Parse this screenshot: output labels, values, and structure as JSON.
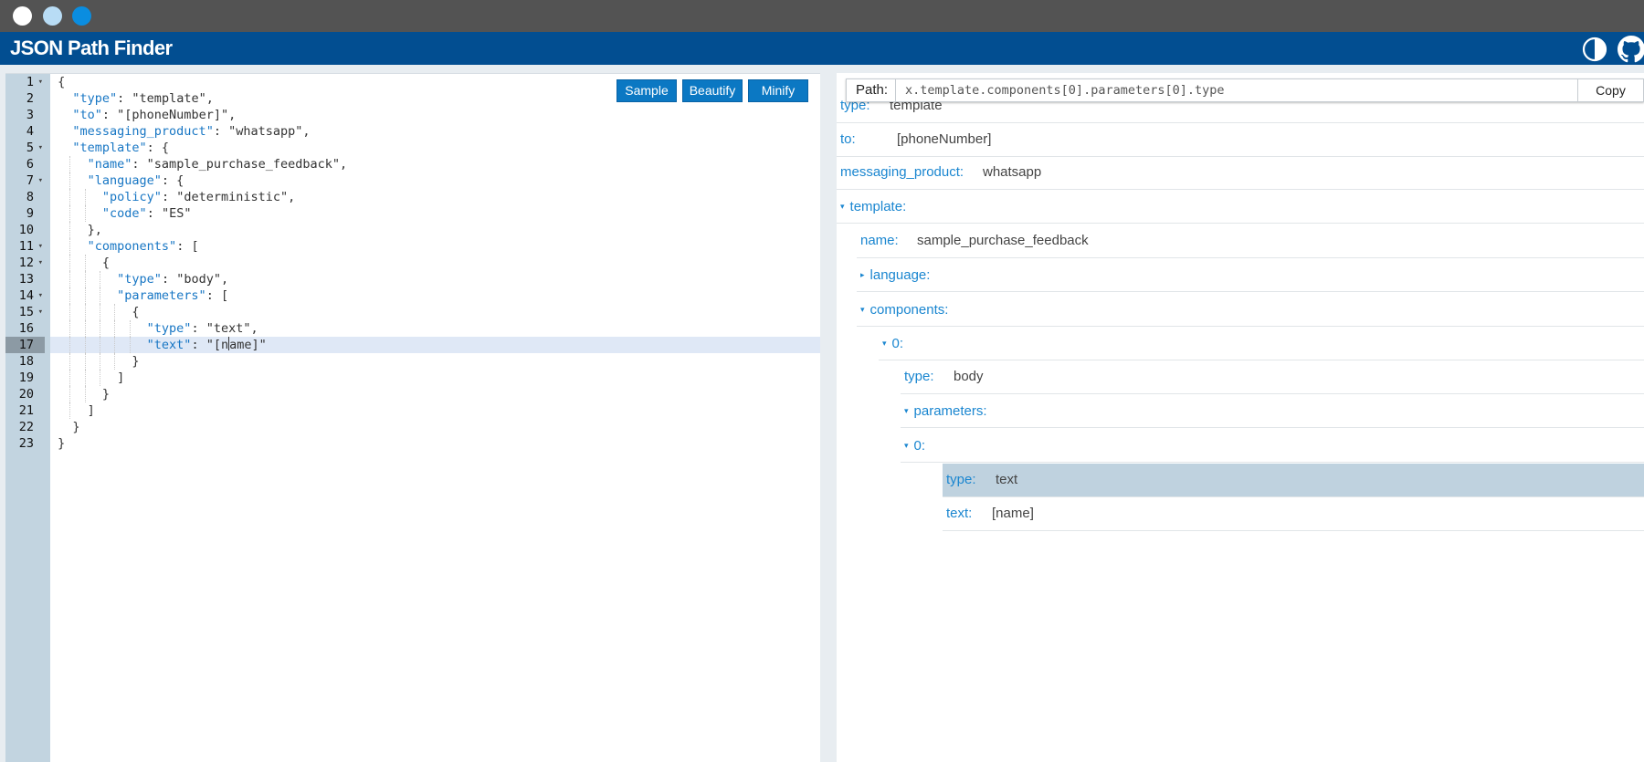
{
  "app": {
    "title": "JSON Path Finder"
  },
  "header_icons": {
    "theme": "contrast-toggle-icon",
    "github": "github-icon"
  },
  "editor": {
    "buttons": {
      "sample": "Sample",
      "beautify": "Beautify",
      "minify": "Minify"
    },
    "active_line": 17,
    "lines": [
      "{",
      "  \"type\": \"template\",",
      "  \"to\": \"[phoneNumber]\",",
      "  \"messaging_product\": \"whatsapp\",",
      "  \"template\": {",
      "    \"name\": \"sample_purchase_feedback\",",
      "    \"language\": {",
      "      \"policy\": \"deterministic\",",
      "      \"code\": \"ES\"",
      "    },",
      "    \"components\": [",
      "      {",
      "        \"type\": \"body\",",
      "        \"parameters\": [",
      "          {",
      "            \"type\": \"text\",",
      "            \"text\": \"[name]\"",
      "          }",
      "        ]",
      "      }",
      "    ]",
      "  }",
      "}"
    ],
    "foldable_lines": [
      1,
      5,
      7,
      11,
      12,
      14,
      15
    ]
  },
  "path": {
    "label": "Path:",
    "value": "x.template.components[0].parameters[0].type",
    "copy": "Copy"
  },
  "tree": [
    {
      "key": "type:",
      "value": "template",
      "depth": 0
    },
    {
      "key": "to:",
      "value": "[phoneNumber]",
      "depth": 0
    },
    {
      "key": "messaging_product:",
      "value": "whatsapp",
      "depth": 0
    },
    {
      "key": "template:",
      "value": "",
      "depth": 0,
      "arrow": "▾"
    },
    {
      "key": "name:",
      "value": "sample_purchase_feedback",
      "depth": 1
    },
    {
      "key": "language:",
      "value": "",
      "depth": 1,
      "arrow": "▸"
    },
    {
      "key": "components:",
      "value": "",
      "depth": 1,
      "arrow": "▾"
    },
    {
      "key": "0:",
      "value": "",
      "depth": 2,
      "arrow": "▾"
    },
    {
      "key": "type:",
      "value": "body",
      "depth": 3
    },
    {
      "key": "parameters:",
      "value": "",
      "depth": 3,
      "arrow": "▾"
    },
    {
      "key": "0:",
      "value": "",
      "depth": 4,
      "arrow": "▾"
    },
    {
      "key": "type:",
      "value": "text",
      "depth": 5,
      "selected": true
    },
    {
      "key": "text:",
      "value": "[name]",
      "depth": 5
    }
  ]
}
